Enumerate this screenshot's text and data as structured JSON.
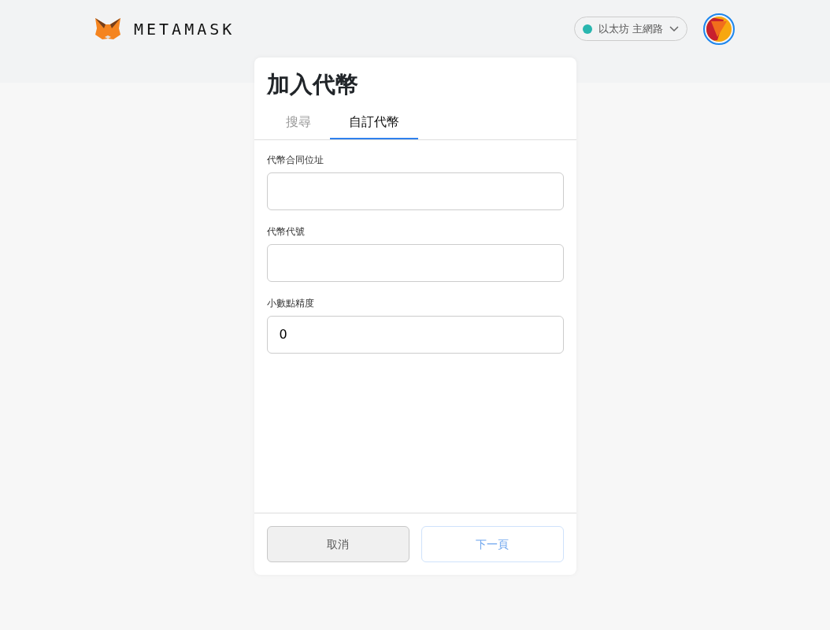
{
  "header": {
    "logo_text": "METAMASK",
    "network": {
      "label": "以太坊 主網路",
      "color": "#29b6af"
    }
  },
  "dialog": {
    "title": "加入代幣",
    "tabs": [
      {
        "label": "搜尋",
        "selected": false
      },
      {
        "label": "自訂代幣",
        "selected": true
      }
    ],
    "fields": [
      {
        "label": "代幣合同位址"
      },
      {
        "label": "代幣代號"
      },
      {
        "label": "小數點精度",
        "value": "0"
      }
    ],
    "buttons": [
      {
        "label": "取消",
        "kind": "cancel",
        "disabled": false
      },
      {
        "label": "下一頁",
        "kind": "next",
        "disabled": true
      }
    ]
  }
}
